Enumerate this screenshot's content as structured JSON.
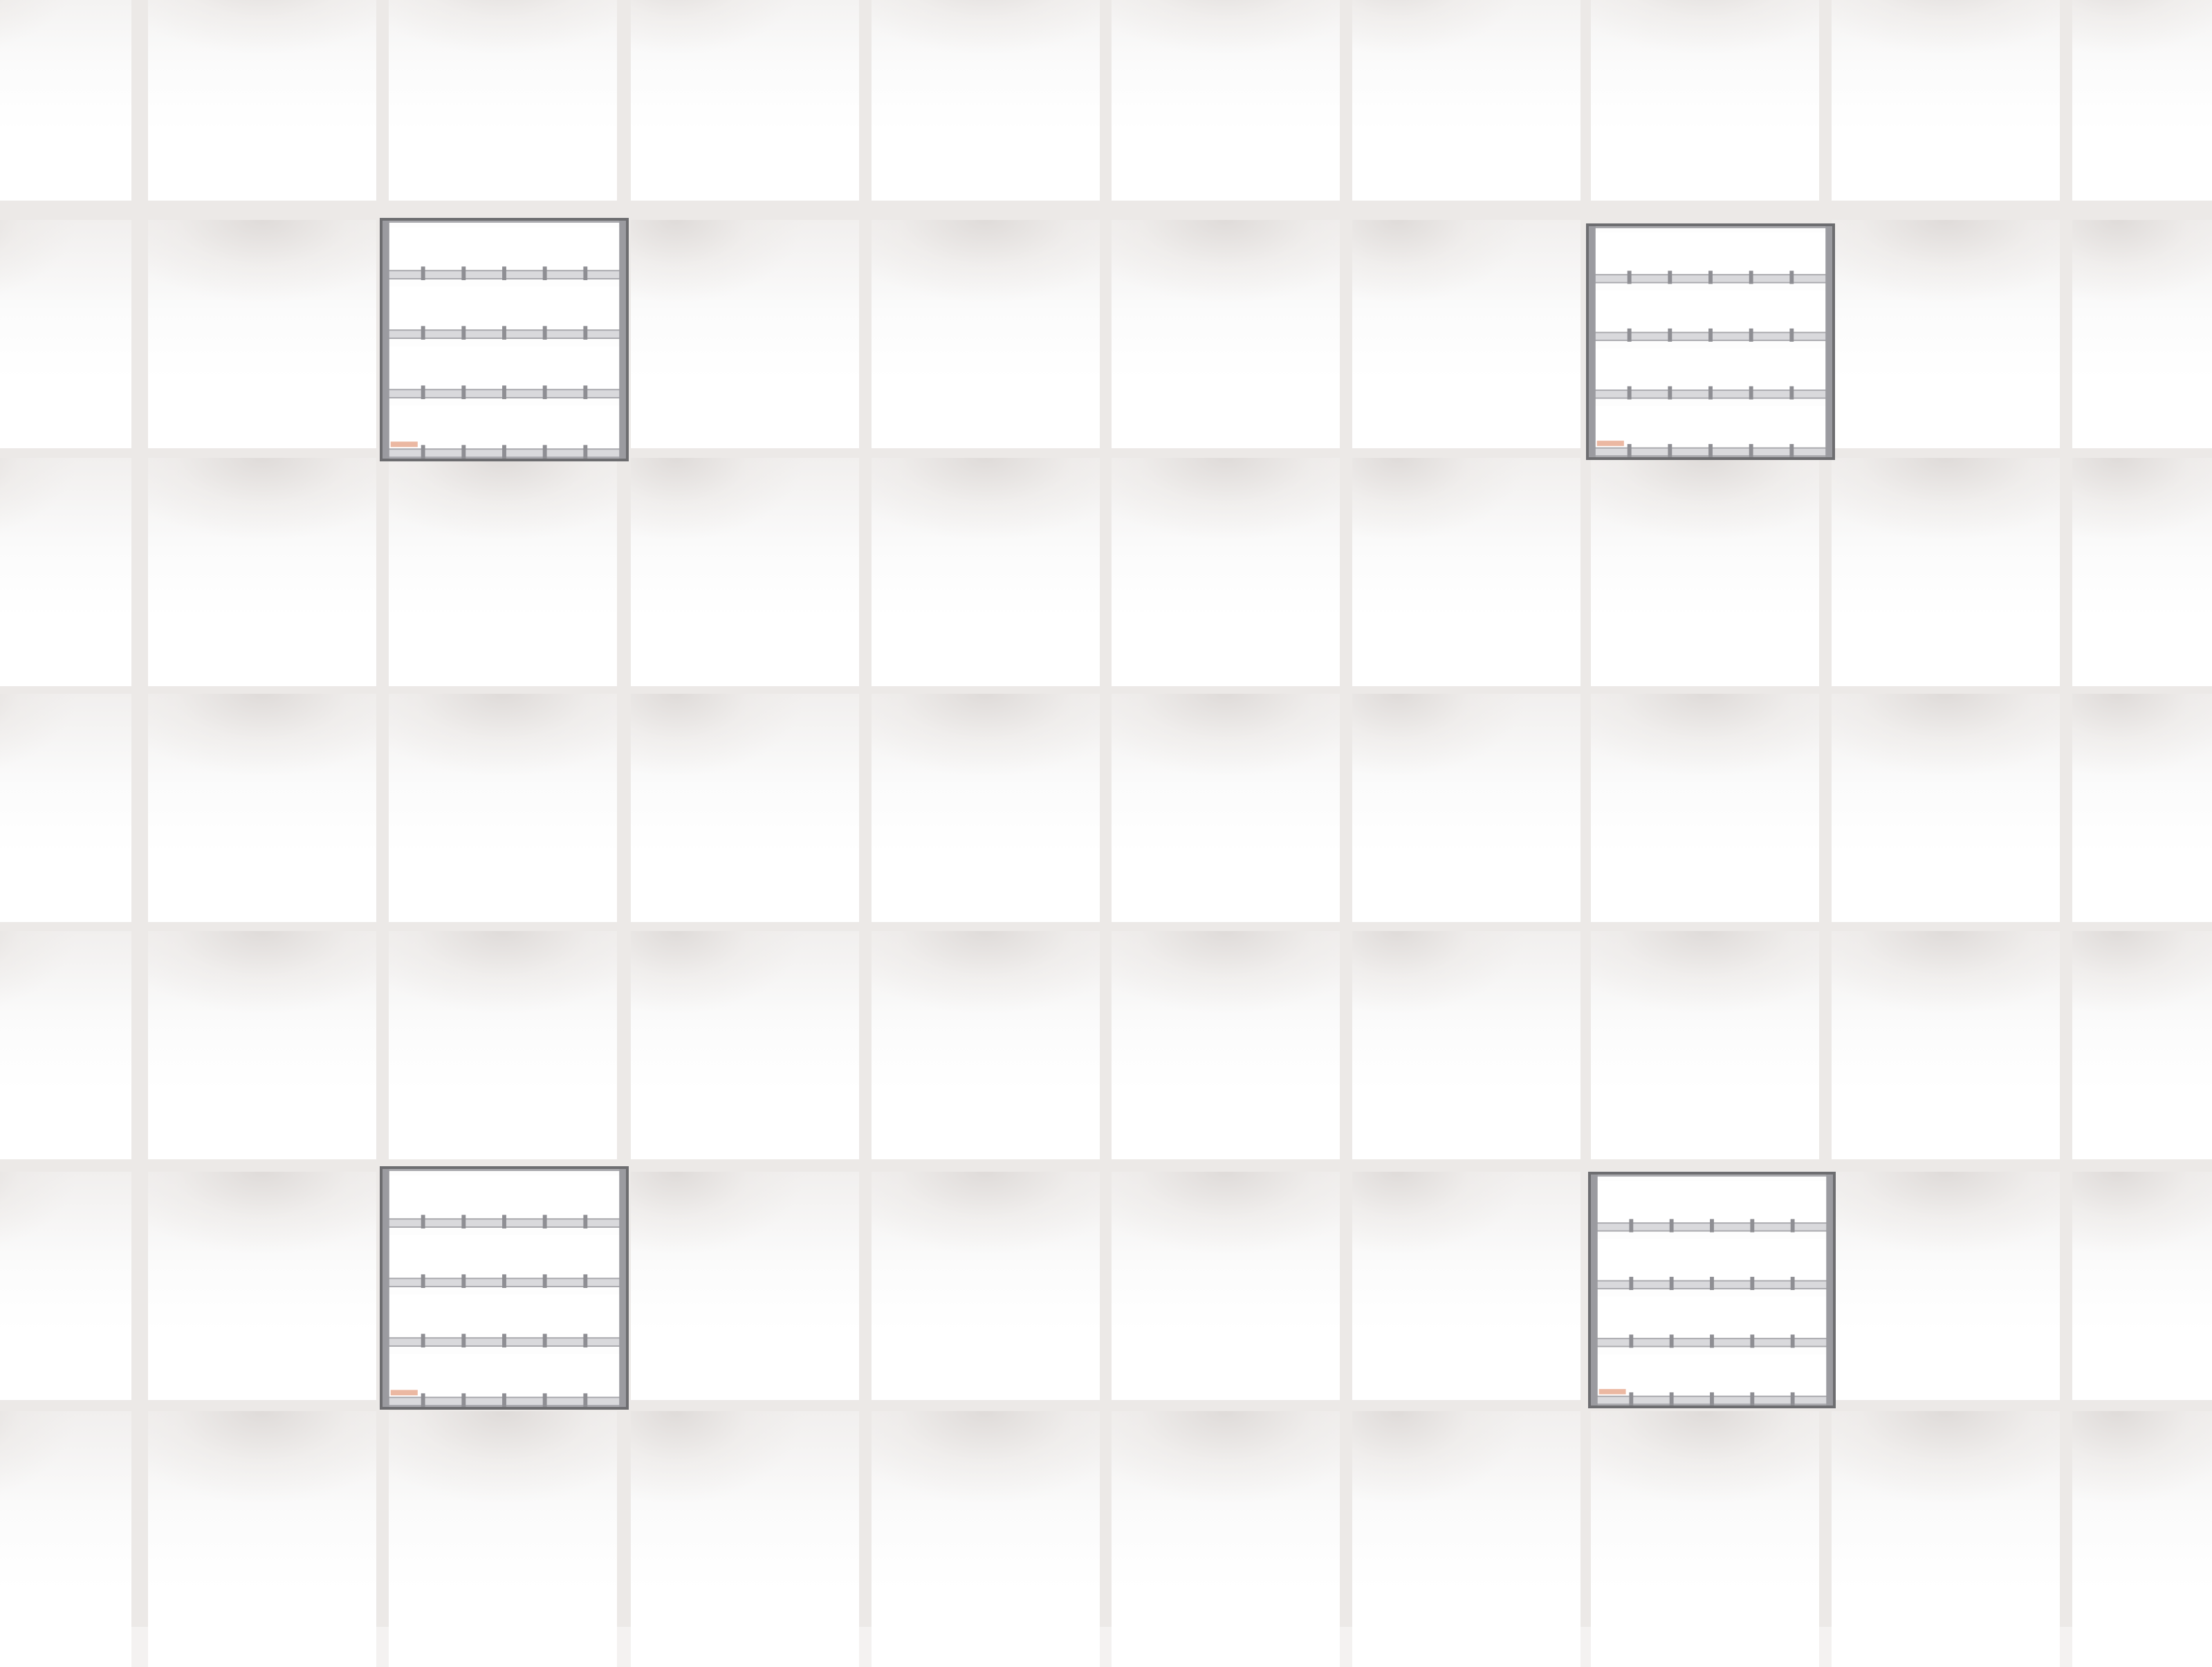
{
  "scene": {
    "subject": "ceiling-grid",
    "colors": {
      "tile": "#ffffff",
      "tile_shadow": "#dedad8",
      "grid_line": "#ece9e7",
      "fixture_frame": "#6d6d70",
      "fixture_louver": "#a9a9ad",
      "tube_glow": "#ffffff",
      "accent_warm": "#e39a7a"
    },
    "fixtures": [
      {
        "id": "fixture-top-left",
        "tubes": 4
      },
      {
        "id": "fixture-top-right",
        "tubes": 4
      },
      {
        "id": "fixture-bottom-left",
        "tubes": 4
      },
      {
        "id": "fixture-bottom-right",
        "tubes": 4
      }
    ]
  }
}
